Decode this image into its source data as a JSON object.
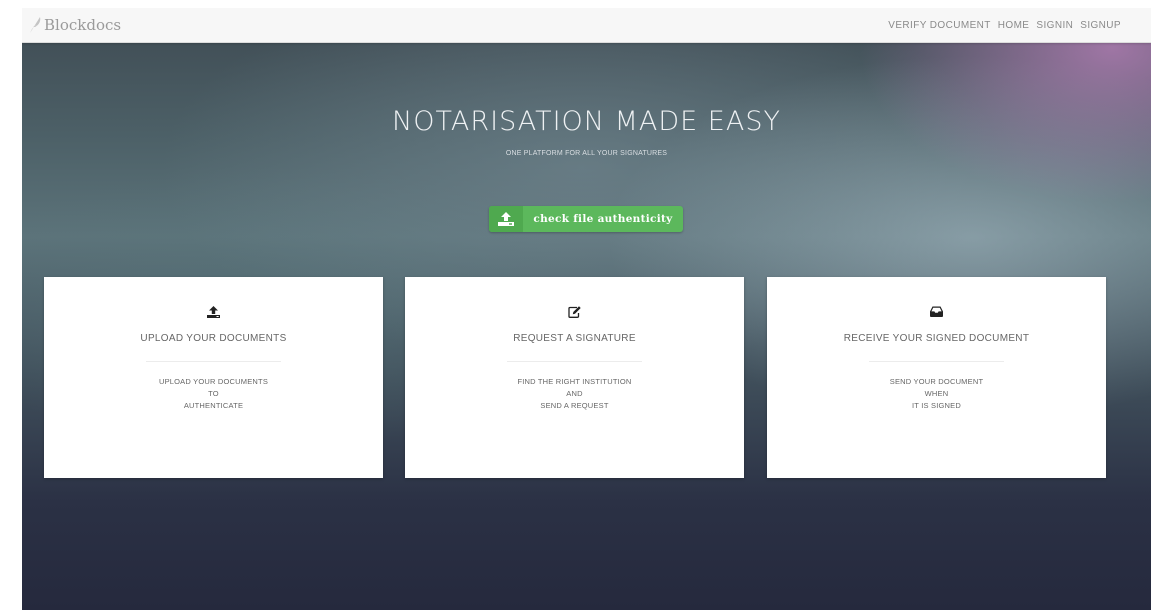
{
  "navbar": {
    "brand": "Blockdocs",
    "links": [
      "VERIFY DOCUMENT",
      "HOME",
      "SIGNIN",
      "SIGNUP"
    ]
  },
  "hero": {
    "title": "NOTARISATION MADE EASY",
    "subtitle": "ONE PLATFORM FOR ALL YOUR SIGNATURES",
    "cta_label": "check file authenticity",
    "cta_icon": "upload-icon"
  },
  "cards": [
    {
      "icon": "upload-icon",
      "title": "UPLOAD YOUR DOCUMENTS",
      "lines": [
        "UPLOAD YOUR DOCUMENTS",
        "TO",
        "AUTHENTICATE"
      ]
    },
    {
      "icon": "edit-icon",
      "title": "REQUEST A SIGNATURE",
      "lines": [
        "FIND THE RIGHT INSTITUTION",
        "AND",
        "SEND A REQUEST"
      ]
    },
    {
      "icon": "inbox-icon",
      "title": "RECEIVE YOUR SIGNED DOCUMENT",
      "lines": [
        "SEND YOUR DOCUMENT",
        "WHEN",
        "IT IS SIGNED"
      ]
    }
  ],
  "colors": {
    "accent_green": "#5cb85c",
    "navbar_bg": "#f7f7f7",
    "card_text": "#666666"
  }
}
